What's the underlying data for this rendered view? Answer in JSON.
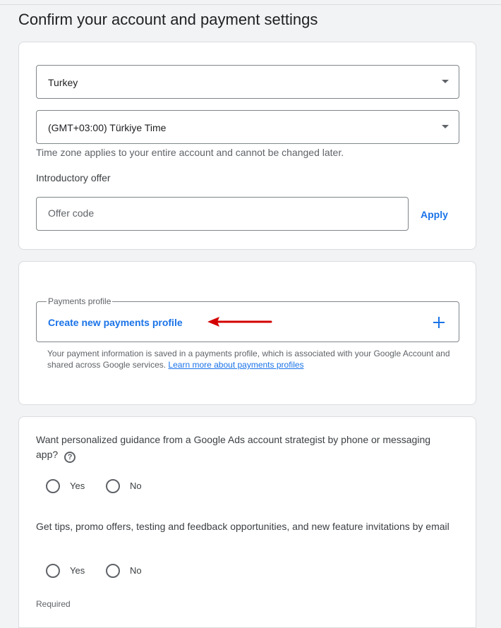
{
  "page": {
    "title": "Confirm your account and payment settings"
  },
  "settings": {
    "country_value": "Turkey",
    "timezone_value": "(GMT+03:00) Türkiye Time",
    "timezone_hint": "Time zone applies to your entire account and cannot be changed later.",
    "offer_label": "Introductory offer",
    "offer_placeholder": "Offer code",
    "apply_label": "Apply"
  },
  "payments": {
    "legend": "Payments profile",
    "create_label": "Create new payments profile",
    "info_text": "Your payment information is saved in a payments profile, which is associated with your Google Account and shared across Google services.",
    "learn_more": "Learn more about payments profiles",
    "annotation_color": "#d40000"
  },
  "preferences": {
    "question1": "Want personalized guidance from a Google Ads account strategist by phone or messaging app?",
    "question1_yes": "Yes",
    "question1_no": "No",
    "question2": "Get tips, promo offers, testing and feedback opportunities, and new feature invitations by email",
    "question2_yes": "Yes",
    "question2_no": "No",
    "required_label": "Required"
  },
  "icons": {
    "dropdown": "caret-down-icon",
    "add": "plus-icon",
    "help": "help-circle-icon",
    "help_glyph": "?",
    "arrow": "red-arrow-annotation"
  }
}
